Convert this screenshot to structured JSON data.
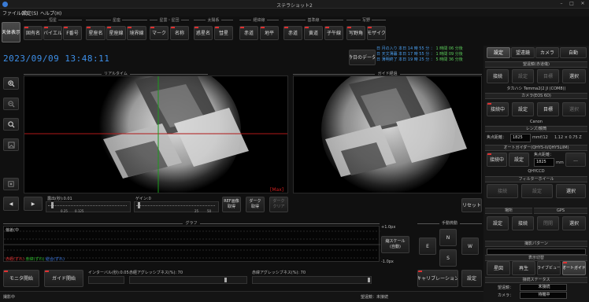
{
  "window": {
    "title": "ステラショット2",
    "minimize": "–",
    "maximize": "□",
    "close": "✕"
  },
  "menu": [
    "ファイル(F)",
    "設定(S)",
    "ヘルプ(H)"
  ],
  "toolbar": {
    "realtime_label": "天体表示",
    "groups": [
      {
        "title": "恒星",
        "buttons": [
          "固有名",
          "バイエル",
          "F番号"
        ]
      },
      {
        "title": "星座",
        "buttons": [
          "星座名",
          "星座線",
          "境界線"
        ]
      },
      {
        "title": "星雲・星団",
        "buttons": [
          "マーク",
          "名称"
        ]
      },
      {
        "title": "太陽系",
        "buttons": [
          "惑星名",
          "彗星"
        ]
      },
      {
        "title": "経緯線",
        "buttons": [
          "赤道",
          "地平"
        ]
      },
      {
        "title": "基準線",
        "buttons": [
          "赤道",
          "黄道",
          "子午線"
        ]
      },
      {
        "title": "写野",
        "buttons": [
          "写野角",
          "モザイク"
        ]
      }
    ]
  },
  "clock": "2023/09/09 13:48:11",
  "today_data_button": "今日のデータ",
  "schedule": [
    {
      "text": "日 月の入り 本日 14 時 55 分 ：",
      "remain": "1 時間 06 分後"
    },
    {
      "text": "日 天文薄暮 本日 17 時 55 分 ：",
      "remain": "1 時間 09 分後"
    },
    {
      "text": "日 薄明終了 本日 19 時 25 分 ：",
      "remain": "5 時間 36 分後"
    }
  ],
  "realtime": {
    "title": "リアルタイム",
    "max_label": "[Max]"
  },
  "guide": {
    "title": "ガイド経過"
  },
  "zoom_buttons": [
    "🔍+",
    "🔍−",
    "🔍",
    "⊡",
    "⊞"
  ],
  "exposure": {
    "label": "露出(秒):0.01",
    "ticks": [
      "0.25",
      "0.125"
    ]
  },
  "gain": {
    "label": "ゲイン:0",
    "ticks": [
      "25",
      "50"
    ]
  },
  "ref_button": "REF画像\n取得",
  "dark_button": "ダーク\n取得",
  "dark2_button": "ダーク\nクリア",
  "reset_button": "リセット",
  "nav_left": "◀",
  "nav_right": "▶",
  "graph": {
    "title": "グラフ",
    "caption": "偏差(中",
    "legend_red": "赤経(ずれ)",
    "legend_green": "赤緯(ずれ)",
    "legend_blue": "総合(ずれ)",
    "ymax": "+1.0px",
    "ymin": "-1.0px",
    "scale_button": "縮スケール\n(自動)"
  },
  "manual": {
    "title": "手動微動",
    "n": "N",
    "s": "S",
    "e": "E",
    "w": "W"
  },
  "bottom": {
    "monitor_btn": "モニタ開始",
    "guide_btn": "ガイド開始",
    "interval": "インターバル(秒):0.05",
    "ra_aggr": "赤経アグレッシブネス(%): 70",
    "dec_aggr": "赤緯アグレッシブネス(%): 70",
    "calib_btn": "キャリブレーション",
    "settings_btn": "設定"
  },
  "status": {
    "left": "撮影中",
    "scope": "望遠鏡：未接続"
  },
  "right": {
    "tabs": [
      "設定",
      "望遠鏡",
      "カメラ",
      "自動"
    ],
    "scope_section": "望遠鏡(赤道儀)",
    "scope_buttons": [
      "接続",
      "設定",
      "目標",
      "選択"
    ],
    "scope_model": "タカハシ Temma2(2 JI (COM8))",
    "camera_section": "カメラ(EOS 6D)",
    "camera_buttons": [
      "接続中",
      "設定",
      "目標",
      "選択"
    ],
    "camera_name": "Canon",
    "lens_section": "レンズ/鏡筒",
    "focal_label": "焦点距離：",
    "focal_value": "1825",
    "focal_unit": "mm",
    "fratio": "f/12",
    "pixel": "1.12 × 0.75 Z",
    "autoguider_section": "オートガイダー(QHY5-II/QHY5LIIM)",
    "ag_buttons": [
      "接続中",
      "設定"
    ],
    "ag_focal_label": "焦点距離：",
    "ag_focal_value": "1825",
    "ag_unit": "mm",
    "ag_camera": "QHYCCD",
    "filter_section": "フィルターホイール",
    "filter_buttons": [
      "接続",
      "設定",
      "選択"
    ],
    "location_section": "場所",
    "gps_label": "GPS",
    "location_buttons": [
      "設定",
      "接続",
      "閉開",
      "選択"
    ],
    "pattern_section": "撮影パターン",
    "display_section": "表示切替",
    "display_buttons": [
      "星図",
      "再生",
      "ライブビュー",
      "オートガイド"
    ],
    "conn_section": "接続ステータス",
    "conn_rows": [
      {
        "k": "望遠鏡：",
        "v": "未接続"
      },
      {
        "k": "カメラ：",
        "v": "待機中"
      }
    ]
  }
}
